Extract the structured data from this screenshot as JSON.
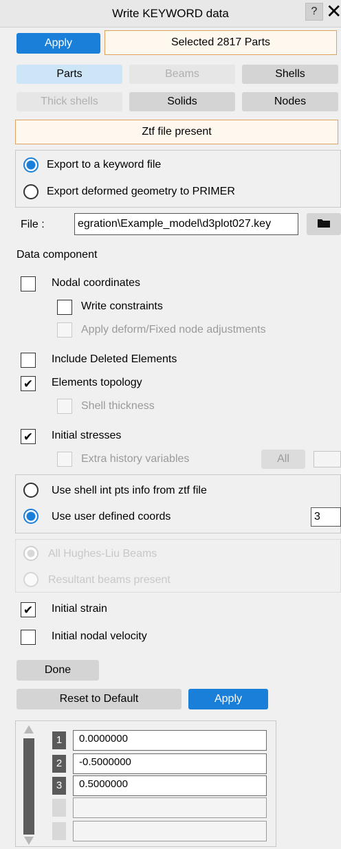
{
  "window": {
    "title": "Write KEYWORD data",
    "help": "?",
    "close": "✕"
  },
  "top": {
    "apply_label": "Apply",
    "selection_text": "Selected 2817 Parts"
  },
  "entity_tabs": [
    {
      "label": "Parts",
      "state": "selected"
    },
    {
      "label": "Beams",
      "state": "disabled"
    },
    {
      "label": "Shells",
      "state": "normal"
    },
    {
      "label": "Thick shells",
      "state": "disabled"
    },
    {
      "label": "Solids",
      "state": "normal"
    },
    {
      "label": "Nodes",
      "state": "normal"
    }
  ],
  "ztf_status": "Ztf file present",
  "export_mode": {
    "options": [
      {
        "label": "Export to a keyword file",
        "selected": true
      },
      {
        "label": "Export deformed geometry to PRIMER",
        "selected": false
      }
    ]
  },
  "file": {
    "label": "File :",
    "value": "egration\\Example_model\\d3plot027.key",
    "browse_icon": "folder-icon"
  },
  "data_component": {
    "heading": "Data component",
    "nodal_coordinates": {
      "label": "Nodal coordinates",
      "checked": false
    },
    "write_constraints": {
      "label": "Write constraints",
      "checked": false
    },
    "apply_deform": {
      "label": "Apply deform/Fixed node adjustments",
      "checked": false
    },
    "include_deleted": {
      "label": "Include Deleted Elements",
      "checked": false
    },
    "elements_topology": {
      "label": "Elements topology",
      "checked": true
    },
    "shell_thickness": {
      "label": "Shell thickness",
      "checked": false
    },
    "initial_stresses": {
      "label": "Initial stresses",
      "checked": true
    },
    "extra_history": {
      "label": "Extra history variables",
      "checked": false,
      "all_label": "All"
    },
    "int_pts": {
      "options": [
        {
          "label": "Use shell int pts info from ztf file",
          "selected": false
        },
        {
          "label": "Use user defined coords",
          "selected": true
        }
      ],
      "coords_count": "3"
    },
    "beams": {
      "options": [
        {
          "label": "All Hughes-Liu Beams",
          "selected": true
        },
        {
          "label": "Resultant beams present",
          "selected": false
        }
      ]
    },
    "initial_strain": {
      "label": "Initial strain",
      "checked": true
    },
    "initial_velocity": {
      "label": "Initial nodal velocity",
      "checked": false
    }
  },
  "bottom": {
    "done_label": "Done",
    "reset_label": "Reset to Default",
    "apply_label": "Apply"
  },
  "coords_table": {
    "rows": [
      {
        "n": "1",
        "value": "0.0000000"
      },
      {
        "n": "2",
        "value": "-0.5000000"
      },
      {
        "n": "3",
        "value": "0.5000000"
      },
      {
        "n": "",
        "value": ""
      },
      {
        "n": "",
        "value": ""
      }
    ]
  },
  "check_mark": "✔"
}
